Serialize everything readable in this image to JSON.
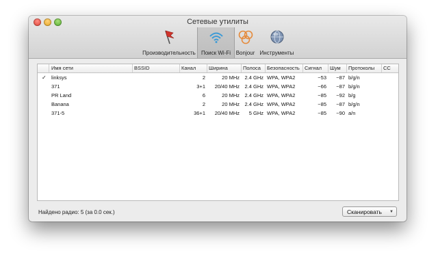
{
  "window": {
    "title": "Сетевые утилиты"
  },
  "toolbar": [
    {
      "name": "performance",
      "label": "Производительность",
      "icon": "flag-icon"
    },
    {
      "name": "wifi-scan",
      "label": "Поиск Wi-Fi",
      "icon": "wifi-icon",
      "selected": true
    },
    {
      "name": "bonjour",
      "label": "Bonjour",
      "icon": "bonjour-icon"
    },
    {
      "name": "tools",
      "label": "Инструменты",
      "icon": "globe-icon"
    }
  ],
  "table": {
    "headers": {
      "ssid": "Имя сети",
      "bssid": "BSSID",
      "channel": "Канал",
      "width": "Ширина",
      "band": "Полоса",
      "security": "Безопасность",
      "signal": "Сигнал",
      "noise": "Шум",
      "protocols": "Протоколы",
      "cc": "CC"
    },
    "rows": [
      {
        "check": "✓",
        "ssid": "linksys",
        "bssid": "",
        "channel": "2",
        "width": "20 MHz",
        "band": "2.4 GHz",
        "security": "WPA, WPA2",
        "signal": "−53",
        "noise": "−87",
        "protocols": "b/g/n",
        "cc": ""
      },
      {
        "check": "",
        "ssid": "371",
        "bssid": "",
        "channel": "3+1",
        "width": "20/40 MHz",
        "band": "2.4 GHz",
        "security": "WPA, WPA2",
        "signal": "−66",
        "noise": "−87",
        "protocols": "b/g/n",
        "cc": ""
      },
      {
        "check": "",
        "ssid": "PR Land",
        "bssid": "",
        "channel": "6",
        "width": "20 MHz",
        "band": "2.4 GHz",
        "security": "WPA, WPA2",
        "signal": "−85",
        "noise": "−92",
        "protocols": "b/g",
        "cc": ""
      },
      {
        "check": "",
        "ssid": "Banana",
        "bssid": "",
        "channel": "2",
        "width": "20 MHz",
        "band": "2.4 GHz",
        "security": "WPA, WPA2",
        "signal": "−85",
        "noise": "−87",
        "protocols": "b/g/n",
        "cc": ""
      },
      {
        "check": "",
        "ssid": "371-5",
        "bssid": "",
        "channel": "36+1",
        "width": "20/40 MHz",
        "band": "5 GHz",
        "security": "WPA, WPA2",
        "signal": "−85",
        "noise": "−90",
        "protocols": "a/n",
        "cc": ""
      }
    ]
  },
  "status": {
    "text": "Найдено радио: 5 (за 0.0 сек.)"
  },
  "scan_button": {
    "label": "Сканировать",
    "arrow": "▼"
  }
}
